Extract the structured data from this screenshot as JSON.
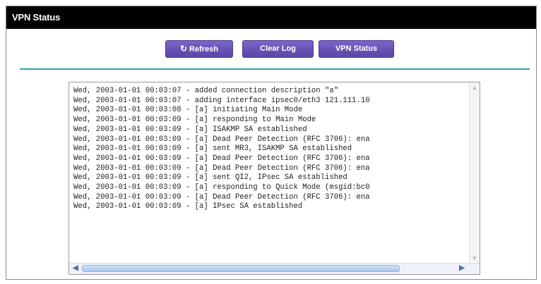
{
  "window": {
    "title": "VPN Status"
  },
  "toolbar": {
    "refresh_label": "Refresh",
    "clear_log_label": "Clear Log",
    "vpn_status_label": "VPN Status"
  },
  "log": {
    "lines": [
      "Wed, 2003-01-01 00:03:07 - added connection description \"a\"",
      "Wed, 2003-01-01 00:03:07 - adding interface ipsec0/eth3 121.111.10",
      "Wed, 2003-01-01 00:03:08 - [a] initiating Main Mode",
      "Wed, 2003-01-01 00:03:09 - [a] responding to Main Mode",
      "Wed, 2003-01-01 00:03:09 - [a] ISAKMP SA established",
      "Wed, 2003-01-01 00:03:09 - [a] Dead Peer Detection (RFC 3706): ena",
      "Wed, 2003-01-01 00:03:09 - [a] sent MR3, ISAKMP SA established",
      "Wed, 2003-01-01 00:03:09 - [a] Dead Peer Detection (RFC 3706): ena",
      "Wed, 2003-01-01 00:03:09 - [a] Dead Peer Detection (RFC 3706): ena",
      "Wed, 2003-01-01 00:03:09 - [a] sent QI2, IPsec SA established",
      "Wed, 2003-01-01 00:03:09 - [a] responding to Quick Mode (msgid:bc0",
      "Wed, 2003-01-01 00:03:09 - [a] Dead Peer Detection (RFC 3706): ena",
      "Wed, 2003-01-01 00:03:09 - [a] IPsec SA established"
    ]
  },
  "icons": {
    "refresh": "refresh-icon",
    "scroll_left": "arrow-left-icon",
    "scroll_right": "arrow-right-icon",
    "scroll_up": "arrow-up-icon",
    "scroll_down": "arrow-down-icon"
  },
  "colors": {
    "titlebar": "#000000",
    "button": "#5a45a8",
    "divider": "#2aa0b0"
  }
}
